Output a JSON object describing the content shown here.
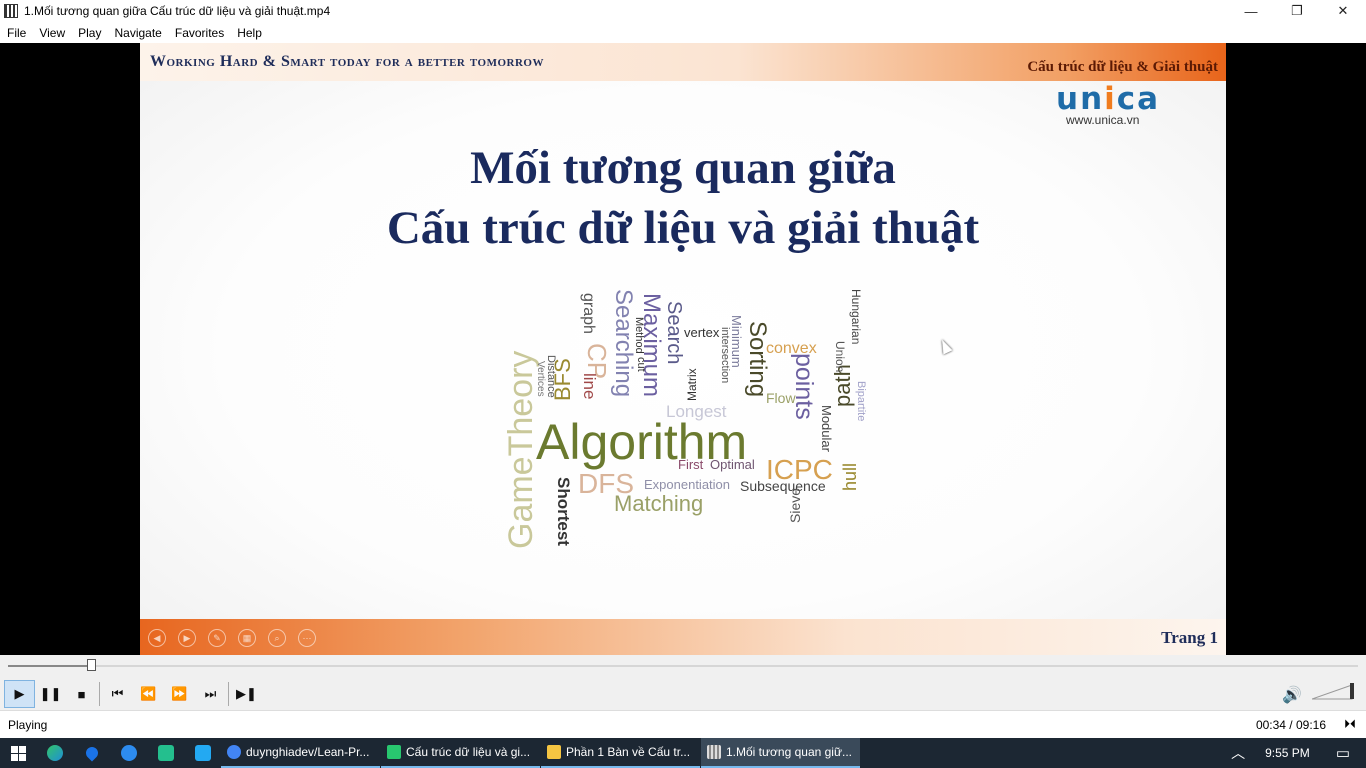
{
  "window": {
    "title": "1.Mối tương quan giữa Cấu trúc dữ liệu và giải thuật.mp4",
    "controls": {
      "minimize": "—",
      "restore": "❐",
      "close": "✕"
    }
  },
  "menu": [
    "File",
    "View",
    "Play",
    "Navigate",
    "Favorites",
    "Help"
  ],
  "slide": {
    "slogan": "Working Hard & Smart today for a better tomorrow",
    "course": "Cấu trúc dữ liệu & Giải thuật",
    "logo_un": "un",
    "logo_i": "i",
    "logo_ca": "ca",
    "logo_url": "www.unica.vn",
    "title_line1": "Mối tương quan giữa",
    "title_line2": "Cấu trúc dữ liệu và giải thuật",
    "page": "Trang 1",
    "wordcloud": [
      "Algorithm",
      "GameTheory",
      "Shortest",
      "Matching",
      "DFS",
      "ICPC",
      "Subsequence",
      "Exponentiation",
      "Optimal",
      "First",
      "Longest",
      "Sorting",
      "points",
      "Searching",
      "Maximum",
      "Search",
      "graph",
      "BFS",
      "CP",
      "line",
      "path",
      "hull",
      "Sieve",
      "Modular",
      "convex",
      "Union",
      "Hungarian",
      "Bipartite",
      "Flow",
      "Minimum",
      "vertex",
      "Matrix",
      "Method",
      "cut",
      "Distance",
      "Vertices",
      "intersection"
    ]
  },
  "player": {
    "progress_fraction": 0.06,
    "buttons": {
      "play": "▶",
      "pause": "❚❚",
      "stop": "■",
      "prev": "⏮",
      "rewind": "⏪",
      "forward": "⏩",
      "next": "⏭",
      "frame_step": "▶❚"
    },
    "volume_icon": "speaker-icon"
  },
  "status": {
    "state": "Playing",
    "time": "00:34 / 09:16",
    "extra": "⏵⏴"
  },
  "taskbar": {
    "tasks": [
      {
        "label": "duynghiadev/Lean-Pr...",
        "color": "#4285f4"
      },
      {
        "label": "Cấu trúc dữ liệu và gi...",
        "color": "#28c76f"
      },
      {
        "label": "Phần 1 Bàn về Cấu tr...",
        "color": "#f5c542"
      },
      {
        "label": "1.Mối tương quan giữ...",
        "color": "#cccccc"
      }
    ],
    "clock": "9:55 PM"
  }
}
